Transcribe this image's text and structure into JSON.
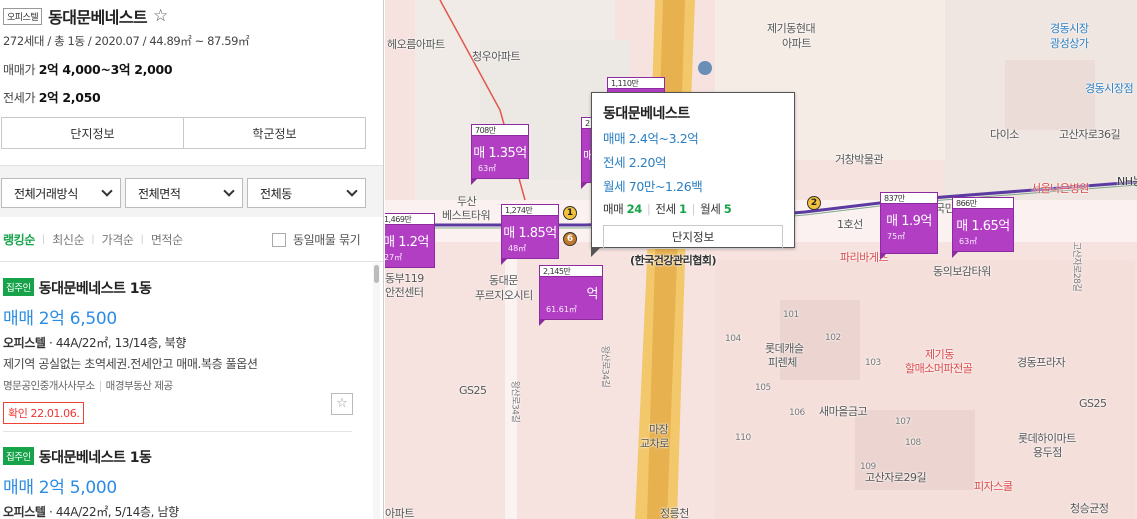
{
  "complex": {
    "type_badge": "오피스텔",
    "name": "동대문베네스트",
    "favorite_icon": "star-outline",
    "meta": "272세대 / 총 1동 / 2020.07 / 44.89㎡ ~ 87.59㎡",
    "sale_label": "매매가",
    "sale_value": "2억 4,000~3억 2,000",
    "jeonse_label": "전세가",
    "jeonse_value": "2억 2,050",
    "btn_complex_info": "단지정보",
    "btn_school_info": "학군정보"
  },
  "filters": {
    "trade_type": "전체거래방식",
    "area": "전체면적",
    "dong": "전체동"
  },
  "sort": {
    "options": [
      "랭킹순",
      "최신순",
      "가격순",
      "면적순"
    ],
    "active": "랭킹순",
    "group_label": "동일매물 묶기"
  },
  "listings": [
    {
      "badge": "집주인",
      "name": "동대문베네스트 1동",
      "price": "매매 2억 6,500",
      "type": "오피스텔",
      "spec": "44A/22㎡, 13/14층, 북향",
      "note": "제기역 공실없는 초역세권.전세안고 매매.복층 풀옵션",
      "agency": "명문공인중개사사무소",
      "provider": "매경부동산 제공",
      "confirm": "확인 22.01.06."
    },
    {
      "badge": "집주인",
      "name": "동대문베네스트 1동",
      "price": "매매 2억 5,000",
      "type": "오피스텔",
      "spec": "44A/22㎡, 5/14층, 남향"
    }
  ],
  "map": {
    "popup": {
      "title": "동대문베네스트",
      "sale": "매매 2.4억~3.2억",
      "jeonse": "전세 2.20억",
      "monthly": "월세 70만~1.26백",
      "count_sale_label": "매매",
      "count_sale": "24",
      "count_jeonse_label": "전세",
      "count_jeonse": "1",
      "count_monthly_label": "월세",
      "count_monthly": "5",
      "button": "단지정보"
    },
    "markers": [
      {
        "count": "708만",
        "price": "매 1.35억",
        "area": "63㎡"
      },
      {
        "count": "1,274만",
        "price": "매 1.85억",
        "area": "48㎡"
      },
      {
        "count": "2,145만",
        "price": "억",
        "area": "61.61㎡"
      },
      {
        "count": "1,469만",
        "price": "매 1.2억",
        "area": "27㎡"
      },
      {
        "count": "837만",
        "price": "매 1.9억",
        "area": "75㎡"
      },
      {
        "count": "866만",
        "price": "매 1.65억",
        "area": "63㎡"
      },
      {
        "count": "1,110만",
        "price": "",
        "area": ""
      },
      {
        "count": "2",
        "price": "매",
        "area": ""
      }
    ],
    "labels": {
      "l1": "헤오름아파트",
      "l2": "청우아파트",
      "l3": "제기동현대",
      "l4": "아파트",
      "l5": "경동시장",
      "l6": "광성상가",
      "l7": "경동시장점",
      "l8": "다이소",
      "l9": "고산자로36길",
      "l10": "거창박물관",
      "l11": "서울나은병원",
      "l12": "두산",
      "l13": "베스트타워",
      "l14": "동대문",
      "l15": "푸르지오시티",
      "l16": "동부119",
      "l17": "안전센터",
      "l18": "1호선",
      "l19": "파리바게뜨",
      "l20": "동의보감타워",
      "l21": "롯데캐슬",
      "l22": "피렌체",
      "l23": "제기동",
      "l24": "할매소머파전골",
      "l25": "경동프라자",
      "l26": "GS25",
      "l27": "새마을금고",
      "l28": "마장",
      "l29": "교차로",
      "l30": "롯데하이마트",
      "l31": "용두점",
      "l32": "고산자로29길",
      "l33": "피자스쿨",
      "l34": "청승균정",
      "l35": "(한국건강관리협회)",
      "l36": "NH농",
      "l37": "정릉천",
      "l38": "아파트",
      "l39": "GS25",
      "l40": "국민",
      "l41": "왕산로34길",
      "l42": "왕산로34길",
      "l43": "고산자로28길",
      "n101": "101",
      "n104": "104",
      "n105": "105",
      "n106": "106",
      "n107": "107",
      "n108": "108",
      "n109": "109",
      "n110": "110",
      "n102": "102",
      "n103": "103"
    },
    "subway": {
      "line1": "1",
      "line6": "6",
      "line2": "2"
    }
  }
}
